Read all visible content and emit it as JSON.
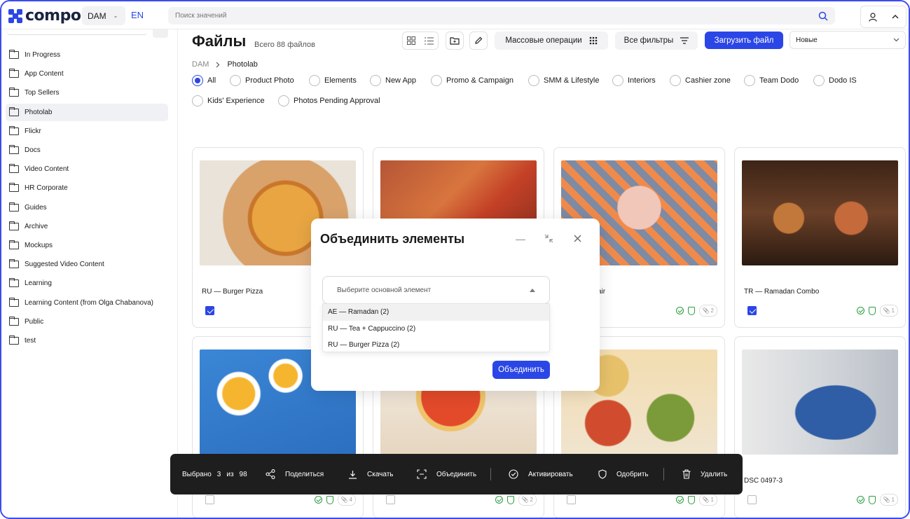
{
  "header": {
    "logo_text": "compo",
    "dam_select": "DAM",
    "lang": "EN",
    "search_placeholder": "Поиск значений"
  },
  "sidebar": {
    "items": [
      {
        "label": "In Progress",
        "active": false
      },
      {
        "label": "App Content",
        "active": false
      },
      {
        "label": "Top Sellers",
        "active": false
      },
      {
        "label": "Photolab",
        "active": true
      },
      {
        "label": "Flickr",
        "active": false
      },
      {
        "label": "Docs",
        "active": false
      },
      {
        "label": "Video Content",
        "active": false
      },
      {
        "label": "HR Corporate",
        "active": false
      },
      {
        "label": "Guides",
        "active": false
      },
      {
        "label": "Archive",
        "active": false
      },
      {
        "label": "Mockups",
        "active": false
      },
      {
        "label": "Suggested Video Content",
        "active": false
      },
      {
        "label": "Learning",
        "active": false
      },
      {
        "label": "Learning Content (from Olga Chabanova)",
        "active": false
      },
      {
        "label": "Public",
        "active": false
      },
      {
        "label": "test",
        "active": false
      }
    ]
  },
  "main": {
    "title": "Файлы",
    "count": "Всего 88 файлов",
    "mass_ops_label": "Массовые операции",
    "filters_label": "Все фильтры",
    "upload_label": "Загрузить файл",
    "sort_value": "Новые",
    "breadcrumb": {
      "root": "DAM",
      "current": "Photolab"
    },
    "categories": [
      {
        "label": "All",
        "selected": true
      },
      {
        "label": "Product Photo",
        "selected": false
      },
      {
        "label": "Elements",
        "selected": false
      },
      {
        "label": "New App",
        "selected": false
      },
      {
        "label": "Promo & Campaign",
        "selected": false
      },
      {
        "label": "SMM & Lifestyle",
        "selected": false
      },
      {
        "label": "Interiors",
        "selected": false
      },
      {
        "label": "Cashier zone",
        "selected": false
      },
      {
        "label": "Team Dodo",
        "selected": false
      },
      {
        "label": "Dodo IS",
        "selected": false
      },
      {
        "label": "Kids' Experience",
        "selected": false
      },
      {
        "label": "Photos Pending Approval",
        "selected": false
      }
    ]
  },
  "cards": [
    {
      "title": "RU — Burger Pizza",
      "checked": true,
      "attachments": ""
    },
    {
      "title": "",
      "checked": false,
      "attachments": ""
    },
    {
      "title": "hake on chair",
      "checked": false,
      "attachments": "2"
    },
    {
      "title": "TR — Ramadan Combo",
      "checked": true,
      "attachments": "1"
    },
    {
      "title": "",
      "checked": false,
      "attachments": "4"
    },
    {
      "title": "",
      "checked": false,
      "attachments": "2"
    },
    {
      "title": "",
      "checked": false,
      "attachments": "1"
    },
    {
      "title": "DSC 0497-3",
      "checked": false,
      "attachments": "1"
    }
  ],
  "modal": {
    "title": "Объединить элементы",
    "select_placeholder": "Выберите основной элемент",
    "options": [
      "AE — Ramadan (2)",
      "RU — Tea + Cappuccino (2)",
      "RU — Burger Pizza (2)"
    ],
    "highlighted_option": 0,
    "submit_label": "Объединить"
  },
  "actionbar": {
    "selected_prefix": "Выбрано",
    "selected_count": "3",
    "of_label": "из",
    "total": "98",
    "share_label": "Поделиться",
    "download_label": "Скачать",
    "merge_label": "Объединить",
    "activate_label": "Активировать",
    "approve_label": "Одобрить",
    "delete_label": "Удалить"
  },
  "colors": {
    "accent": "#2b46e6",
    "approved_green": "#2a9d3e",
    "actionbar_bg": "#1e1e1e"
  }
}
